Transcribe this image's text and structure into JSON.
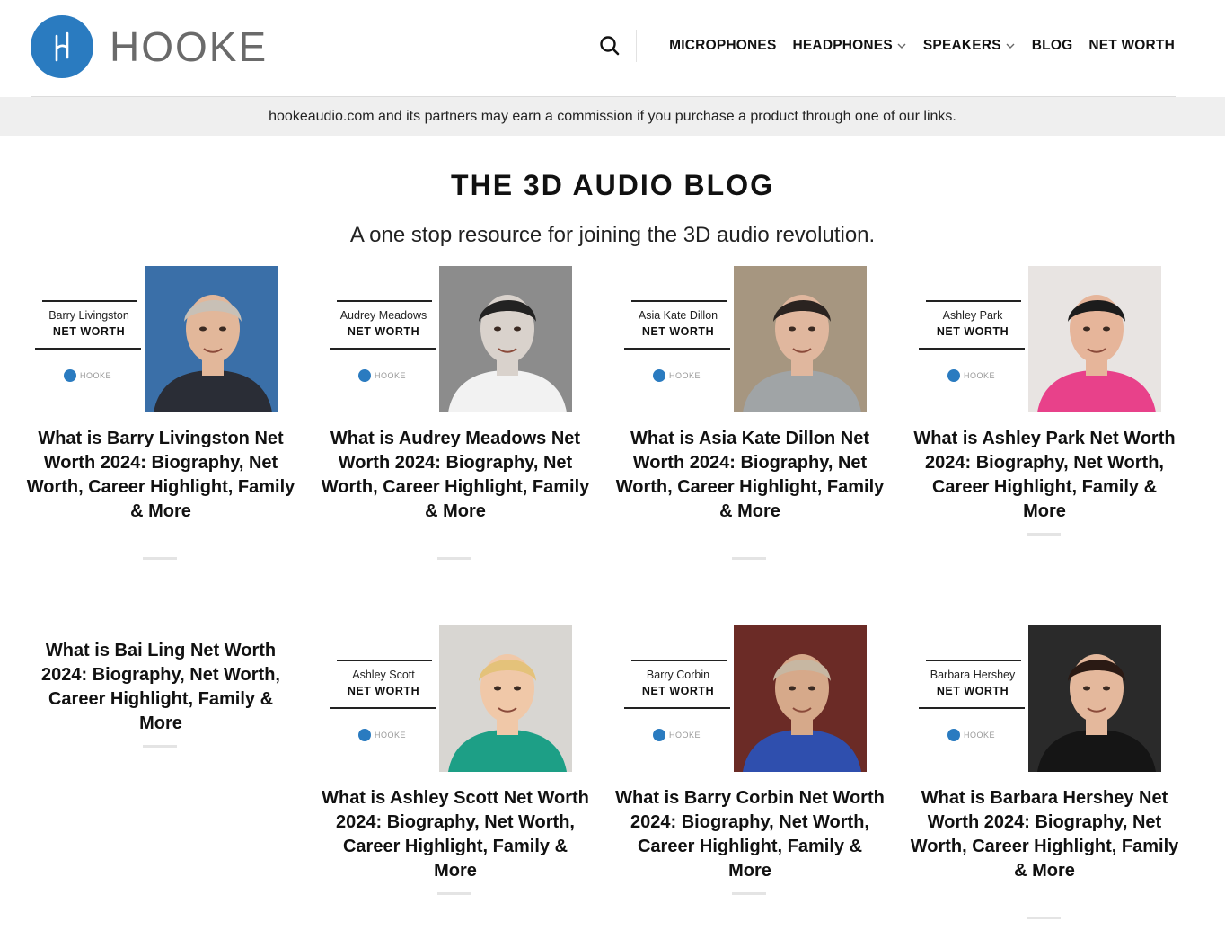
{
  "brand": {
    "name": "HOOKE",
    "logo_color": "#2a7bc0"
  },
  "nav": {
    "search_icon": "search-icon",
    "items": [
      {
        "label": "MICROPHONES",
        "dropdown": false
      },
      {
        "label": "HEADPHONES",
        "dropdown": true
      },
      {
        "label": "SPEAKERS",
        "dropdown": true
      },
      {
        "label": "BLOG",
        "dropdown": false
      },
      {
        "label": "NET WORTH",
        "dropdown": false
      }
    ]
  },
  "disclosure": "hookeaudio.com and its partners may earn a commission if you purchase a product through one of our links.",
  "page": {
    "title": "THE 3D AUDIO BLOG",
    "subtitle": "A one stop resource for joining the 3D audio revolution."
  },
  "thumb_common": {
    "net_worth_label": "NET WORTH",
    "logo_text": "HOOKE"
  },
  "posts": [
    {
      "thumb_name": "Barry Livingston",
      "title": "What is Barry Livingston Net Worth 2024: Biography, Net Worth, Career Highlight, Family & More",
      "has_image": true,
      "bg": "#3a6fa8"
    },
    {
      "thumb_name": "Audrey Meadows",
      "title": "What is Audrey Meadows Net Worth 2024: Biography, Net Worth, Career Highlight, Family & More",
      "has_image": true,
      "bg": "#8c8c8c"
    },
    {
      "thumb_name": "Asia Kate Dillon",
      "title": "What is Asia Kate Dillon Net Worth 2024: Biography, Net Worth, Career Highlight, Family & More",
      "has_image": true,
      "bg": "#a69680"
    },
    {
      "thumb_name": "Ashley Park",
      "title": "What is Ashley Park Net Worth 2024: Biography, Net Worth, Career Highlight, Family & More",
      "has_image": true,
      "bg": "#e8e4e2"
    },
    {
      "thumb_name": "",
      "title": "What is Bai Ling Net Worth 2024: Biography, Net Worth, Career Highlight, Family & More",
      "has_image": false,
      "bg": ""
    },
    {
      "thumb_name": "Ashley Scott",
      "title": "What is Ashley Scott Net Worth 2024: Biography, Net Worth, Career Highlight, Family & More",
      "has_image": true,
      "bg": "#d8d6d2"
    },
    {
      "thumb_name": "Barry Corbin",
      "title": "What is Barry Corbin Net Worth 2024: Biography, Net Worth, Career Highlight, Family & More",
      "has_image": true,
      "bg": "#6b2b26"
    },
    {
      "thumb_name": "Barbara Hershey",
      "title": "What is Barbara Hershey Net Worth 2024: Biography, Net Worth, Career Highlight, Family & More",
      "has_image": true,
      "bg": "#2a2a2a"
    }
  ]
}
